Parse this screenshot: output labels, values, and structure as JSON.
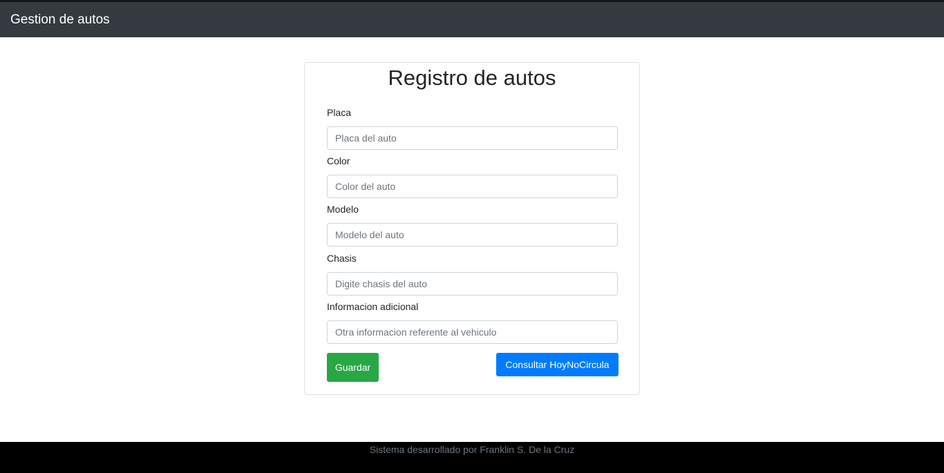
{
  "navbar": {
    "brand": "Gestion de autos"
  },
  "form": {
    "title": "Registro de autos",
    "fields": [
      {
        "label": "Placa",
        "placeholder": "Placa del auto",
        "value": ""
      },
      {
        "label": "Color",
        "placeholder": "Color del auto",
        "value": ""
      },
      {
        "label": "Modelo",
        "placeholder": "Modelo del auto",
        "value": ""
      },
      {
        "label": "Chasis",
        "placeholder": "Digite chasis del auto",
        "value": ""
      },
      {
        "label": "Informacion adicional",
        "placeholder": "Otra informacion referente al vehiculo",
        "value": ""
      }
    ],
    "save_label": "Guardar",
    "check_label": "Consultar HoyNoCircula"
  },
  "footer": {
    "text": "Sistema desarrollado por Franklin S. De la Cruz"
  },
  "colors": {
    "navbar_bg": "#343a40",
    "save_button": "#28a745",
    "check_button": "#007bff",
    "footer_bg": "#000000"
  }
}
